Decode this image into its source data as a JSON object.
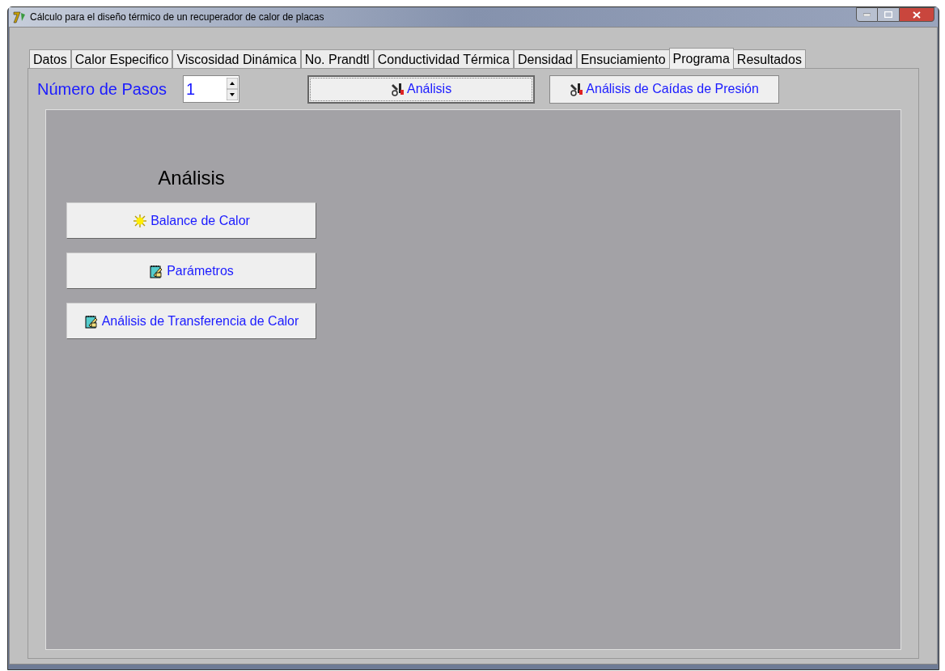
{
  "window": {
    "title": "Cálculo para el diseño térmico de un recuperador de calor de placas"
  },
  "tabs": [
    {
      "label": "Datos",
      "selected": false
    },
    {
      "label": "Calor Especifico",
      "selected": false
    },
    {
      "label": "Viscosidad Dinámica",
      "selected": false
    },
    {
      "label": "No. Prandtl",
      "selected": false
    },
    {
      "label": "Conductividad Térmica",
      "selected": false
    },
    {
      "label": "Densidad",
      "selected": false
    },
    {
      "label": "Ensuciamiento",
      "selected": false
    },
    {
      "label": "Programa",
      "selected": true
    },
    {
      "label": "Resultados",
      "selected": false
    }
  ],
  "steps": {
    "label": "Número de Pasos",
    "value": "1"
  },
  "toolbar_buttons": [
    {
      "label": "Análisis",
      "focused": true
    },
    {
      "label": "Análisis de Caídas de Presión",
      "focused": false
    }
  ],
  "panel": {
    "heading": "Análisis",
    "buttons": [
      {
        "label": "Balance de Calor"
      },
      {
        "label": "Parámetros"
      },
      {
        "label": "Análisis de Transferencia de Calor"
      }
    ]
  }
}
